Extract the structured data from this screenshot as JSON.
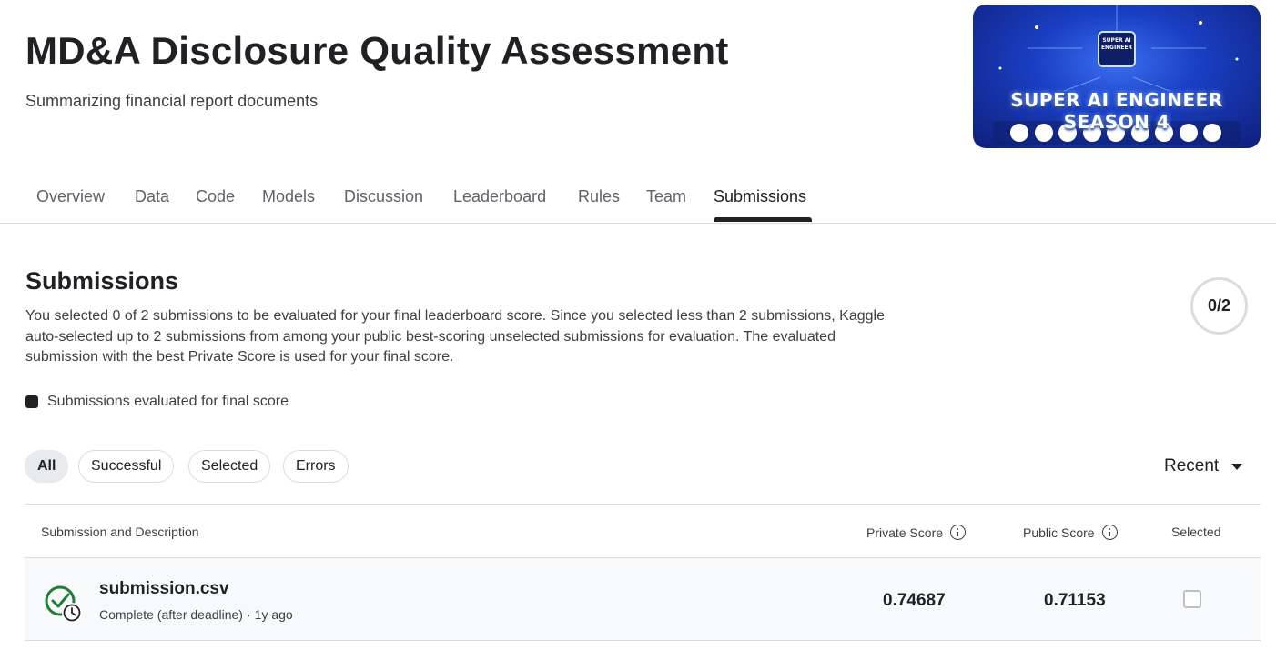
{
  "header": {
    "title": "MD&A Disclosure Quality Assessment",
    "subtitle": "Summarizing financial report documents"
  },
  "banner": {
    "text": "SUPER AI ENGINEER SEASON 4",
    "chip_text": "SUPER AI ENGINEER",
    "colors": {
      "background": "#1a3fc4",
      "glow": "#7fb2ff"
    }
  },
  "tabs": [
    {
      "label": "Overview"
    },
    {
      "label": "Data"
    },
    {
      "label": "Code"
    },
    {
      "label": "Models"
    },
    {
      "label": "Discussion"
    },
    {
      "label": "Leaderboard"
    },
    {
      "label": "Rules"
    },
    {
      "label": "Team"
    },
    {
      "label": "Submissions",
      "active": true
    }
  ],
  "submissions": {
    "title": "Submissions",
    "description": "You selected 0 of 2 submissions to be evaluated for your final leaderboard score. Since you selected less than 2 submissions, Kaggle auto-selected up to 2 submissions from among your public best-scoring unselected submissions for evaluation. The evaluated submission with the best Private Score is used for your final score.",
    "counter": "0/2",
    "legend": "Submissions evaluated for final score"
  },
  "filters": [
    {
      "label": "All",
      "active": true
    },
    {
      "label": "Successful"
    },
    {
      "label": "Selected"
    },
    {
      "label": "Errors"
    }
  ],
  "sort": {
    "label": "Recent",
    "icon": "caret-down-icon"
  },
  "table": {
    "headers": {
      "submission": "Submission and Description",
      "private": "Private Score",
      "public": "Public Score",
      "selected": "Selected"
    },
    "rows": [
      {
        "file": "submission.csv",
        "status": "Complete (after deadline)",
        "separator": "·",
        "age": "1y ago",
        "private_score": "0.74687",
        "public_score": "0.71153",
        "selected": false,
        "status_icon": "check-circle-clock-icon"
      }
    ]
  },
  "colors": {
    "accent": "#202124",
    "success": "#1e7e34",
    "border": "#dadce0"
  }
}
